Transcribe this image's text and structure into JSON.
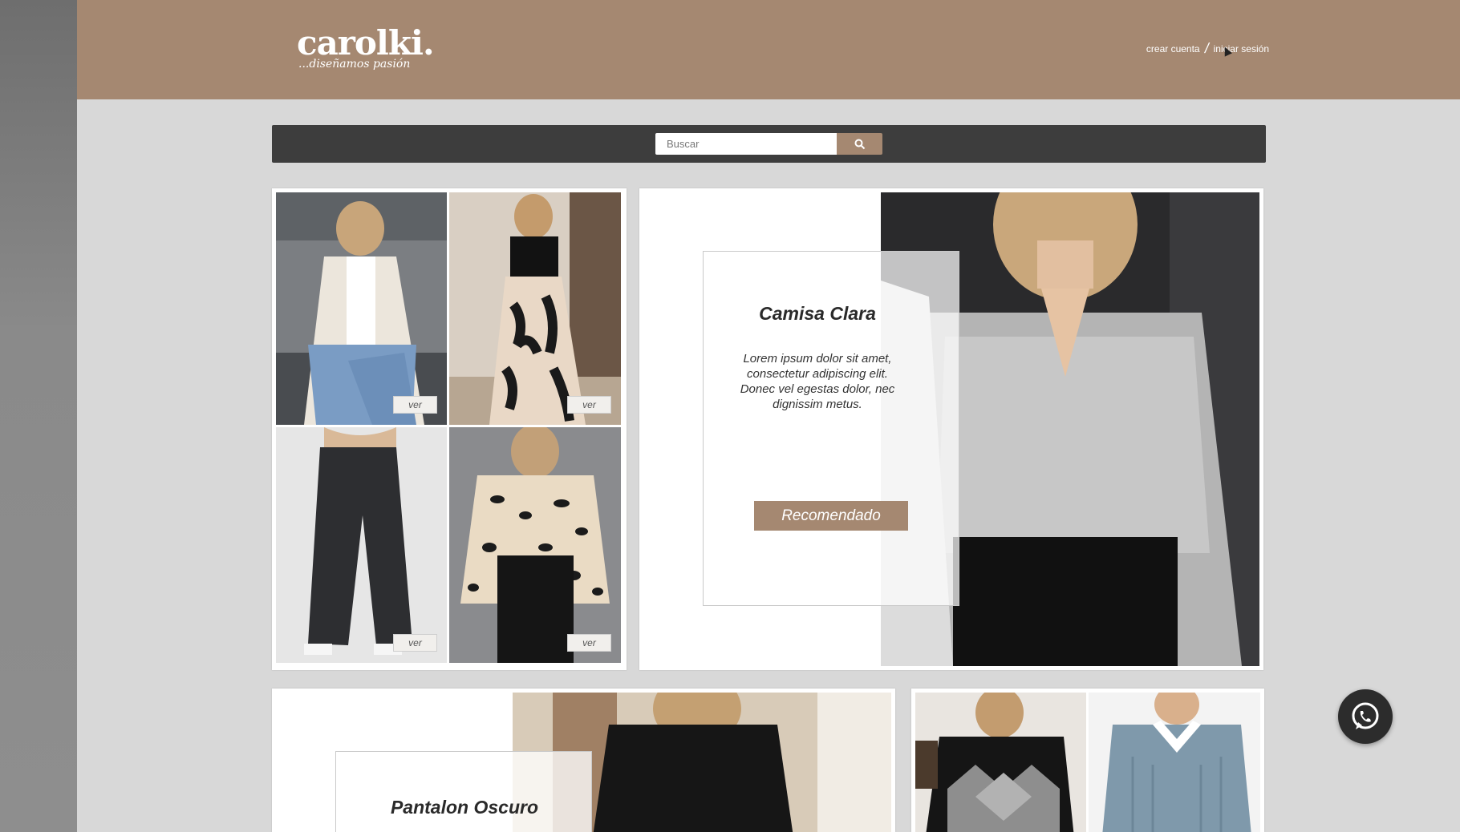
{
  "brand": {
    "name": "carolki.",
    "tagline": "...diseñamos pasión"
  },
  "auth": {
    "create_account": "crear cuenta",
    "separator": "/",
    "login": "iniciar sesión"
  },
  "search": {
    "placeholder": "Buscar"
  },
  "gallery": {
    "items": [
      {
        "label": "ver",
        "description": "white fleece coat with jeans"
      },
      {
        "label": "ver",
        "description": "black top with leaf print pants"
      },
      {
        "label": "ver",
        "description": "black wide leg jeans"
      },
      {
        "label": "ver",
        "description": "leopard print blouse"
      }
    ]
  },
  "featured": {
    "title": "Camisa Clara",
    "text": "Lorem ipsum dolor sit amet, consectetur adipiscing elit. Donec vel egestas dolor, nec dignissim metus.",
    "button": "Recomendado"
  },
  "featured2": {
    "title": "Pantalon Oscuro"
  },
  "colors": {
    "brand": "#a58871",
    "dark_bar": "#3d3d3d",
    "background": "#d8d8d8"
  }
}
